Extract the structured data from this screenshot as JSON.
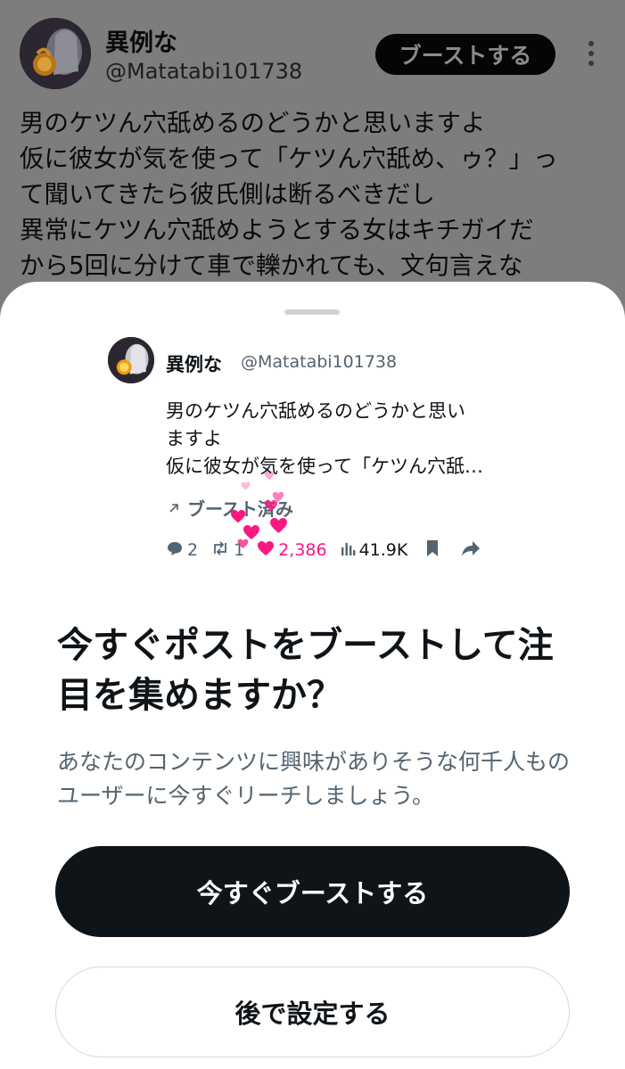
{
  "background_post": {
    "author_name": "異例な",
    "author_handle": "@Matatabi101738",
    "boost_button_label": "ブーストする",
    "text": "男のケツん穴舐めるのどうかと思いますよ\n仮に彼女が気を使って「ケツん穴舐め、ゥ？」っ\nて聞いてきたら彼氏側は断るべきだし\n異常にケツん穴舐めようとする女はキチガイだ\nから5回に分けて車で轢かれても、文句言えな"
  },
  "sheet": {
    "preview": {
      "author_name": "異例な",
      "author_handle": "@Matatabi101738",
      "text": "男のケツん穴舐めるのどうかと思い\nますよ\n仮に彼女が気を使って「ケツん穴舐…",
      "boosted_label": "ブースト済み",
      "stats": {
        "replies": "2",
        "reposts": "1",
        "likes": "2,386",
        "views": "41.9K"
      }
    },
    "headline": "今すぐポストをブーストして注目を集めますか？",
    "description": "あなたのコンテンツに興味がありそうな何千人ものユーザーに今すぐリーチしましょう。",
    "primary_button": "今すぐブーストする",
    "secondary_button": "後で設定する"
  },
  "colors": {
    "like_pink": "#f91880",
    "secondary_text": "#536471",
    "primary_button_bg": "#0f1419"
  }
}
